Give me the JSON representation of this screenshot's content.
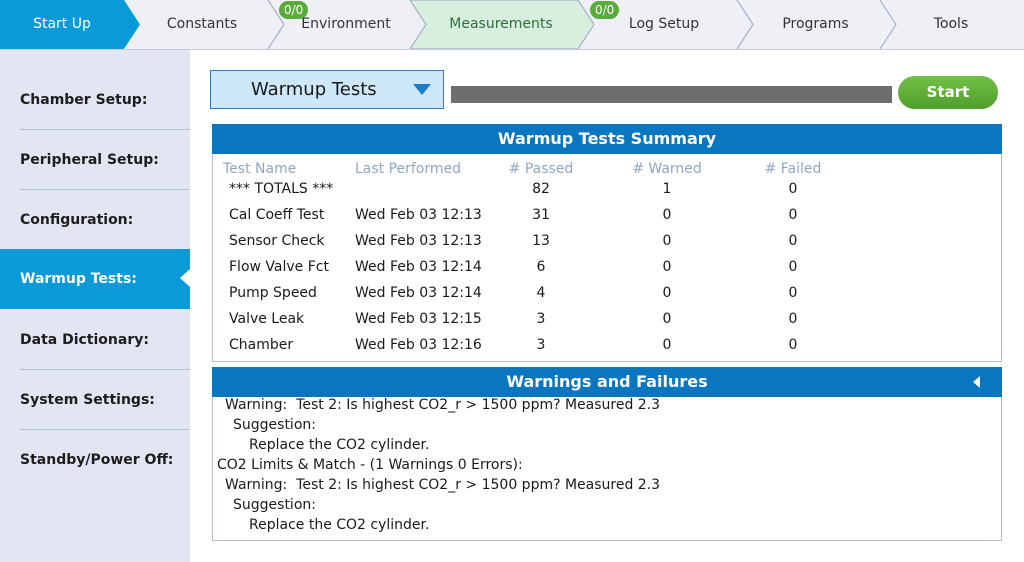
{
  "nav": {
    "tabs": [
      {
        "label": "Start Up",
        "active": true
      },
      {
        "label": "Constants"
      },
      {
        "label": "Environment",
        "badge": "0/0"
      },
      {
        "label": "Measurements",
        "highlighted": true
      },
      {
        "label": "Log Setup",
        "badge": "0/0"
      },
      {
        "label": "Programs"
      },
      {
        "label": "Tools"
      }
    ],
    "colors": {
      "active": "#0a9ad8",
      "highlight": "#d8eede",
      "badge": "#5aaa3c"
    }
  },
  "sidebar": {
    "items": [
      {
        "label": "Chamber Setup:"
      },
      {
        "label": "Peripheral Setup:"
      },
      {
        "label": "Configuration:"
      },
      {
        "label": "Warmup Tests:",
        "active": true
      },
      {
        "label": "Data Dictionary:"
      },
      {
        "label": "System Settings:"
      },
      {
        "label": "Standby/Power Off:"
      }
    ]
  },
  "toolbar": {
    "test_select": "Warmup Tests",
    "start_label": "Start",
    "progress_fraction": 0
  },
  "summary": {
    "title": "Warmup Tests Summary",
    "columns": [
      "Test Name",
      "Last Performed",
      "# Passed",
      "# Warned",
      "# Failed"
    ],
    "rows": [
      [
        "*** TOTALS ***",
        "",
        "82",
        "1",
        "0"
      ],
      [
        "Cal Coeff Test",
        "Wed Feb 03 12:13",
        "31",
        "0",
        "0"
      ],
      [
        "Sensor Check",
        "Wed Feb 03 12:13",
        "13",
        "0",
        "0"
      ],
      [
        "Flow Valve Fct",
        "Wed Feb 03 12:14",
        "6",
        "0",
        "0"
      ],
      [
        "Pump Speed",
        "Wed Feb 03 12:14",
        "4",
        "0",
        "0"
      ],
      [
        "Valve Leak",
        "Wed Feb 03 12:15",
        "3",
        "0",
        "0"
      ],
      [
        "Chamber",
        "Wed Feb 03 12:16",
        "3",
        "0",
        "0"
      ]
    ]
  },
  "warnings": {
    "title": "Warnings and Failures",
    "lines": [
      {
        "text": "Warning:  Test 2: Is highest CO2_r > 1500 ppm? Measured 2.3",
        "indent": 1
      },
      {
        "text": "Suggestion:",
        "indent": 2
      },
      {
        "text": "Replace the CO2 cylinder.",
        "indent": 3
      },
      {
        "text": "CO2 Limits & Match - (1 Warnings 0 Errors):",
        "indent": 0
      },
      {
        "text": "Warning:  Test 2: Is highest CO2_r > 1500 ppm? Measured 2.3",
        "indent": 1
      },
      {
        "text": "Suggestion:",
        "indent": 2
      },
      {
        "text": "Replace the CO2 cylinder.",
        "indent": 3
      }
    ]
  }
}
